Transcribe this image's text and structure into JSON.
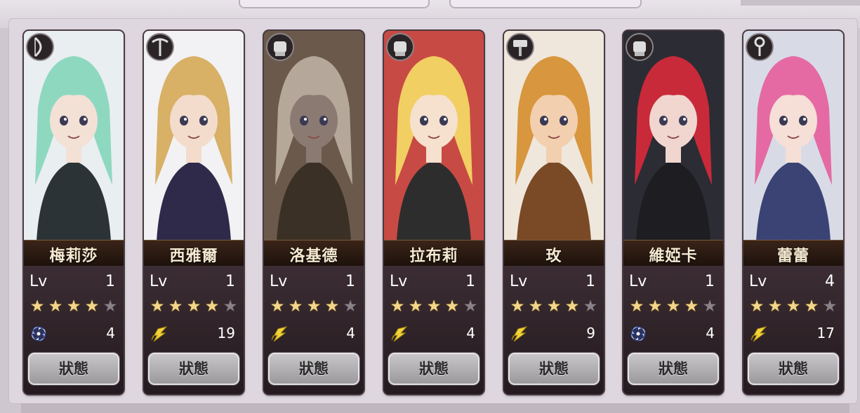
{
  "screen": {
    "button_label": "狀態",
    "level_label": "Lv",
    "max_stars": 5
  },
  "characters": [
    {
      "name": "梅莉莎",
      "level": "1",
      "stars": 4,
      "count": "4",
      "element": "wind-swirl-icon",
      "class_icon": "bow-icon",
      "palette": {
        "bg": "#e9eef0",
        "hair": "#8ed8c0",
        "accent": "#2c3336",
        "skin": "#f3e1d6"
      }
    },
    {
      "name": "西雅爾",
      "level": "1",
      "stars": 4,
      "count": "19",
      "element": "lightning-wing-icon",
      "class_icon": "crossbow-icon",
      "palette": {
        "bg": "#f2f2f4",
        "hair": "#d8b066",
        "accent": "#2f2a4a",
        "skin": "#f3dccb"
      }
    },
    {
      "name": "洛基德",
      "level": "1",
      "stars": 4,
      "count": "4",
      "element": "lightning-wing-icon",
      "class_icon": "gauntlet-icon",
      "palette": {
        "bg": "#6b5a4c",
        "hair": "#b5a89a",
        "accent": "#3b3025",
        "skin": "#8a7a72"
      }
    },
    {
      "name": "拉布莉",
      "level": "1",
      "stars": 4,
      "count": "4",
      "element": "lightning-wing-icon",
      "class_icon": "gauntlet-icon",
      "palette": {
        "bg": "#c84a44",
        "hair": "#f1cf62",
        "accent": "#2d2d2d",
        "skin": "#f6e0ce"
      }
    },
    {
      "name": "玫",
      "level": "1",
      "stars": 4,
      "count": "9",
      "element": "lightning-wing-icon",
      "class_icon": "hammer-icon",
      "palette": {
        "bg": "#efe7dc",
        "hair": "#d8963e",
        "accent": "#7a4a26",
        "skin": "#f2cfae"
      }
    },
    {
      "name": "維婭卡",
      "level": "1",
      "stars": 4,
      "count": "4",
      "element": "wind-swirl-icon",
      "class_icon": "gauntlet-icon",
      "palette": {
        "bg": "#2c2c34",
        "hair": "#c92a3a",
        "accent": "#1d1d22",
        "skin": "#f0d6cf"
      }
    },
    {
      "name": "蕾蕾",
      "level": "4",
      "stars": 4,
      "count": "17",
      "element": "lightning-wing-icon",
      "class_icon": "staff-icon",
      "palette": {
        "bg": "#d8dbe6",
        "hair": "#e56aa4",
        "accent": "#3a4374",
        "skin": "#f6dfd6"
      }
    }
  ]
}
